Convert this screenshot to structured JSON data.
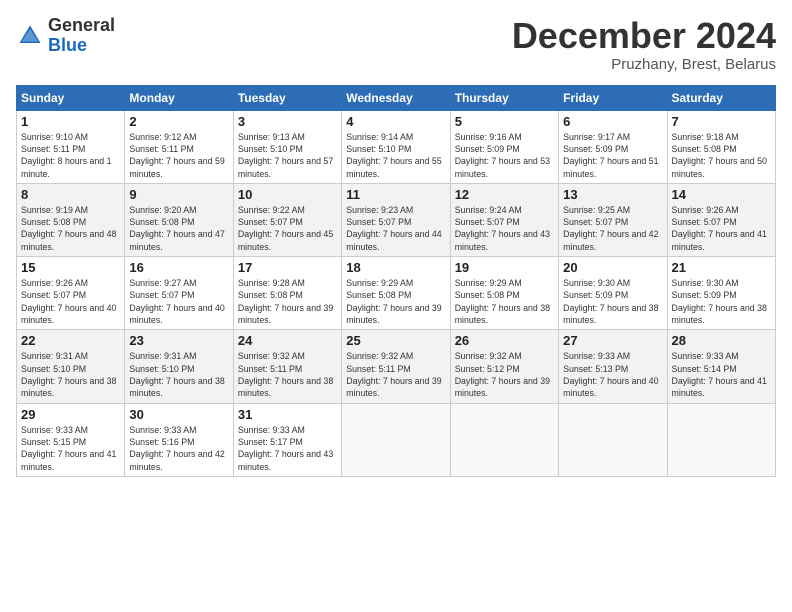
{
  "header": {
    "logo_general": "General",
    "logo_blue": "Blue",
    "month_title": "December 2024",
    "location": "Pruzhany, Brest, Belarus"
  },
  "weekdays": [
    "Sunday",
    "Monday",
    "Tuesday",
    "Wednesday",
    "Thursday",
    "Friday",
    "Saturday"
  ],
  "weeks": [
    [
      {
        "day": "1",
        "sunrise": "9:10 AM",
        "sunset": "5:11 PM",
        "daylight": "8 hours and 1 minute."
      },
      {
        "day": "2",
        "sunrise": "9:12 AM",
        "sunset": "5:11 PM",
        "daylight": "7 hours and 59 minutes."
      },
      {
        "day": "3",
        "sunrise": "9:13 AM",
        "sunset": "5:10 PM",
        "daylight": "7 hours and 57 minutes."
      },
      {
        "day": "4",
        "sunrise": "9:14 AM",
        "sunset": "5:10 PM",
        "daylight": "7 hours and 55 minutes."
      },
      {
        "day": "5",
        "sunrise": "9:16 AM",
        "sunset": "5:09 PM",
        "daylight": "7 hours and 53 minutes."
      },
      {
        "day": "6",
        "sunrise": "9:17 AM",
        "sunset": "5:09 PM",
        "daylight": "7 hours and 51 minutes."
      },
      {
        "day": "7",
        "sunrise": "9:18 AM",
        "sunset": "5:08 PM",
        "daylight": "7 hours and 50 minutes."
      }
    ],
    [
      {
        "day": "8",
        "sunrise": "9:19 AM",
        "sunset": "5:08 PM",
        "daylight": "7 hours and 48 minutes."
      },
      {
        "day": "9",
        "sunrise": "9:20 AM",
        "sunset": "5:08 PM",
        "daylight": "7 hours and 47 minutes."
      },
      {
        "day": "10",
        "sunrise": "9:22 AM",
        "sunset": "5:07 PM",
        "daylight": "7 hours and 45 minutes."
      },
      {
        "day": "11",
        "sunrise": "9:23 AM",
        "sunset": "5:07 PM",
        "daylight": "7 hours and 44 minutes."
      },
      {
        "day": "12",
        "sunrise": "9:24 AM",
        "sunset": "5:07 PM",
        "daylight": "7 hours and 43 minutes."
      },
      {
        "day": "13",
        "sunrise": "9:25 AM",
        "sunset": "5:07 PM",
        "daylight": "7 hours and 42 minutes."
      },
      {
        "day": "14",
        "sunrise": "9:26 AM",
        "sunset": "5:07 PM",
        "daylight": "7 hours and 41 minutes."
      }
    ],
    [
      {
        "day": "15",
        "sunrise": "9:26 AM",
        "sunset": "5:07 PM",
        "daylight": "7 hours and 40 minutes."
      },
      {
        "day": "16",
        "sunrise": "9:27 AM",
        "sunset": "5:07 PM",
        "daylight": "7 hours and 40 minutes."
      },
      {
        "day": "17",
        "sunrise": "9:28 AM",
        "sunset": "5:08 PM",
        "daylight": "7 hours and 39 minutes."
      },
      {
        "day": "18",
        "sunrise": "9:29 AM",
        "sunset": "5:08 PM",
        "daylight": "7 hours and 39 minutes."
      },
      {
        "day": "19",
        "sunrise": "9:29 AM",
        "sunset": "5:08 PM",
        "daylight": "7 hours and 38 minutes."
      },
      {
        "day": "20",
        "sunrise": "9:30 AM",
        "sunset": "5:09 PM",
        "daylight": "7 hours and 38 minutes."
      },
      {
        "day": "21",
        "sunrise": "9:30 AM",
        "sunset": "5:09 PM",
        "daylight": "7 hours and 38 minutes."
      }
    ],
    [
      {
        "day": "22",
        "sunrise": "9:31 AM",
        "sunset": "5:10 PM",
        "daylight": "7 hours and 38 minutes."
      },
      {
        "day": "23",
        "sunrise": "9:31 AM",
        "sunset": "5:10 PM",
        "daylight": "7 hours and 38 minutes."
      },
      {
        "day": "24",
        "sunrise": "9:32 AM",
        "sunset": "5:11 PM",
        "daylight": "7 hours and 38 minutes."
      },
      {
        "day": "25",
        "sunrise": "9:32 AM",
        "sunset": "5:11 PM",
        "daylight": "7 hours and 39 minutes."
      },
      {
        "day": "26",
        "sunrise": "9:32 AM",
        "sunset": "5:12 PM",
        "daylight": "7 hours and 39 minutes."
      },
      {
        "day": "27",
        "sunrise": "9:33 AM",
        "sunset": "5:13 PM",
        "daylight": "7 hours and 40 minutes."
      },
      {
        "day": "28",
        "sunrise": "9:33 AM",
        "sunset": "5:14 PM",
        "daylight": "7 hours and 41 minutes."
      }
    ],
    [
      {
        "day": "29",
        "sunrise": "9:33 AM",
        "sunset": "5:15 PM",
        "daylight": "7 hours and 41 minutes."
      },
      {
        "day": "30",
        "sunrise": "9:33 AM",
        "sunset": "5:16 PM",
        "daylight": "7 hours and 42 minutes."
      },
      {
        "day": "31",
        "sunrise": "9:33 AM",
        "sunset": "5:17 PM",
        "daylight": "7 hours and 43 minutes."
      },
      null,
      null,
      null,
      null
    ]
  ]
}
